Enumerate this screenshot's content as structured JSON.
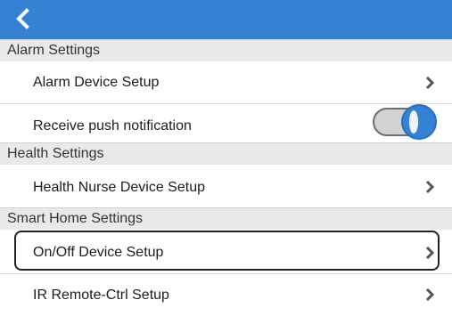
{
  "colors": {
    "header_bg": "#3582d4",
    "section_bg": "#e9e9e9",
    "toggle_on": "#3582d4"
  },
  "header": {
    "back_icon": "chevron-left-icon"
  },
  "sections": {
    "alarm": {
      "title": "Alarm Settings",
      "device_setup_label": "Alarm Device Setup",
      "push_notification_label": "Receive push notification",
      "push_notification_enabled": true
    },
    "health": {
      "title": "Health Settings",
      "nurse_setup_label": "Health Nurse Device Setup"
    },
    "smart_home": {
      "title": "Smart Home Settings",
      "onoff_setup_label": "On/Off Device Setup",
      "ir_remote_label": "IR Remote-Ctrl Setup"
    }
  },
  "row_icon": "chevron-right-icon"
}
